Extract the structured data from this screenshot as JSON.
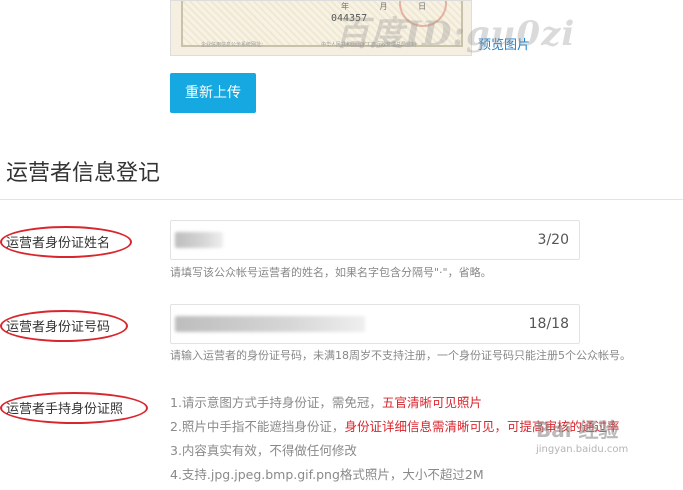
{
  "certificate": {
    "number": "044357",
    "date_chars": "年 月 日",
    "footer_left": "企业信用信息公示系统网址：",
    "footer_right": "中华人民共和国国家工商行政管理总局监制"
  },
  "preview_link": "预览图片",
  "watermark": "百度ID:gu0zi",
  "reupload_button": "重新上传",
  "section_title": "运营者信息登记",
  "fields": {
    "name": {
      "label": "运营者身份证姓名",
      "counter": "3/20",
      "hint": "请填写该公众帐号运营者的姓名，如果名字包含分隔号\"·\"，省略。"
    },
    "id_number": {
      "label": "运营者身份证号码",
      "counter": "18/18",
      "hint": "请输入运营者的身份证号码，未满18周岁不支持注册，一个身份证号码只能注册5个公众帐号。"
    },
    "handheld_photo": {
      "label": "运营者手持身份证照",
      "requirements": [
        {
          "text": "1.请示意图方式手持身份证，需免冠，",
          "highlight": "五官清晰可见照片"
        },
        {
          "text": "2.照片中手指不能遮挡身份证，",
          "highlight": "身份证详细信息需清晰可见，可提高审核的通过率"
        },
        {
          "text": "3.内容真实有效，不得做任何修改",
          "highlight": ""
        },
        {
          "text": "4.支持.jpg.jpeg.bmp.gif.png格式照片，大小不超过2M",
          "highlight": ""
        }
      ]
    }
  },
  "baidu_watermark": {
    "logo": "Bai 经验",
    "url": "jingyan.baidu.com"
  },
  "colors": {
    "accent": "#16a8e0",
    "link": "#1f7fc9",
    "highlight": "#d9262c"
  }
}
